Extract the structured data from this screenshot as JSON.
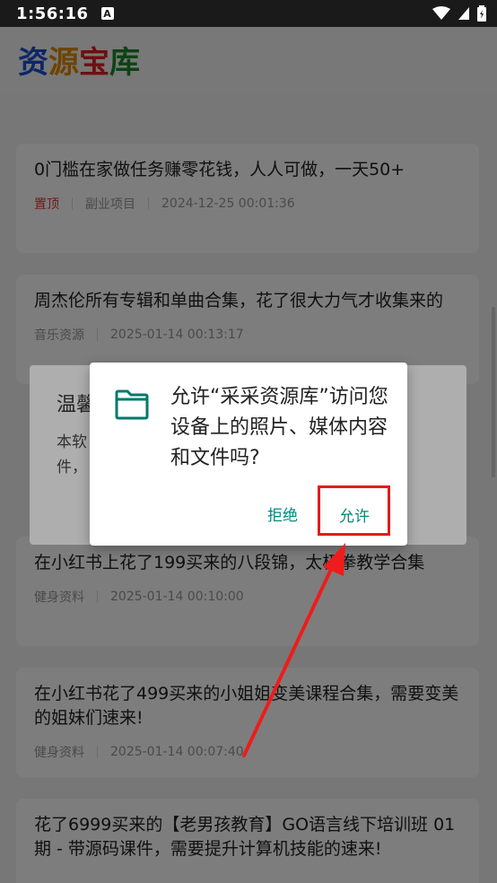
{
  "status_bar": {
    "time": "1:56:16",
    "notification_glyph": "A"
  },
  "app": {
    "logo_chars": [
      {
        "char": "资",
        "color": "#1e4fd6"
      },
      {
        "char": "源",
        "color": "#e08a00"
      },
      {
        "char": "宝",
        "color": "#e32020"
      },
      {
        "char": "库",
        "color": "#1c8a2c"
      }
    ]
  },
  "posts": [
    {
      "title": "0门槛在家做任务赚零花钱，人人可做，一天50+",
      "pin": "置顶",
      "category": "副业项目",
      "time": "2024-12-25 00:01:36"
    },
    {
      "title": "周杰伦所有专辑和单曲合集，花了很大力气才收集来的",
      "category": "音乐资源",
      "time": "2025-01-14 00:13:17"
    },
    {
      "title": "在小红书上花了199买来的八段锦，太极拳教学合集",
      "category": "健身资料",
      "time": "2025-01-14 00:10:00"
    },
    {
      "title": "在小红书花了499买来的小姐姐变美课程合集，需要变美的姐妹们速来!",
      "category": "健身资料",
      "time": "2025-01-14 00:07:40"
    },
    {
      "title": "花了6999买来的【老男孩教育】GO语言线下培训班 01期 - 带源码课件，需要提升计算机技能的速来!"
    }
  ],
  "background_dialog": {
    "title": "温馨",
    "text_line1": "本软",
    "text_line2": "件，"
  },
  "permission_dialog": {
    "message": "允许“采采资源库”访问您设备上的照片、媒体内容和文件吗?",
    "deny_label": "拒绝",
    "allow_label": "允许",
    "accent_color": "#00897b"
  },
  "annotation": {
    "highlight_color": "#e41b1b"
  }
}
